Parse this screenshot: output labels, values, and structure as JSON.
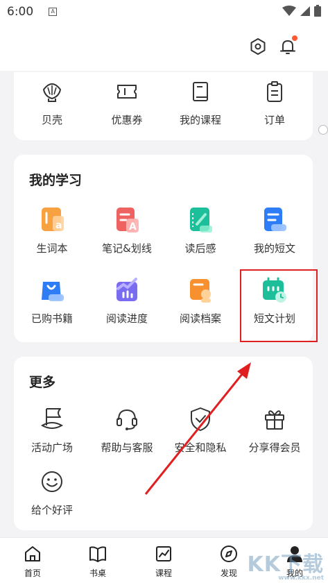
{
  "status": {
    "time": "6:00",
    "sim_label": "A"
  },
  "top_row": [
    {
      "label": "贝壳",
      "icon": "shell-icon"
    },
    {
      "label": "优惠券",
      "icon": "coupon-icon"
    },
    {
      "label": "我的课程",
      "icon": "book-icon"
    },
    {
      "label": "订单",
      "icon": "clipboard-icon"
    }
  ],
  "study": {
    "title": "我的学习",
    "items": [
      {
        "label": "生词本",
        "icon": "vocabulary-icon",
        "color": "#f7902f"
      },
      {
        "label": "笔记&划线",
        "icon": "notes-icon",
        "color": "#ee5a5a"
      },
      {
        "label": "读后感",
        "icon": "reflection-icon",
        "color": "#1dbe9a"
      },
      {
        "label": "我的短文",
        "icon": "essay-icon",
        "color": "#2f7df6"
      },
      {
        "label": "已购书籍",
        "icon": "bag-icon",
        "color": "#2f7df6"
      },
      {
        "label": "阅读进度",
        "icon": "progress-icon",
        "color": "#7a6cf0"
      },
      {
        "label": "阅读档案",
        "icon": "archive-icon",
        "color": "#f7902f"
      },
      {
        "label": "短文计划",
        "icon": "plan-icon",
        "color": "#1dbe9a"
      }
    ]
  },
  "more": {
    "title": "更多",
    "items": [
      {
        "label": "活动广场",
        "icon": "flag-icon"
      },
      {
        "label": "帮助与客服",
        "icon": "headset-icon"
      },
      {
        "label": "安全和隐私",
        "icon": "shield-icon"
      },
      {
        "label": "分享得会员",
        "icon": "gift-icon"
      },
      {
        "label": "给个好评",
        "icon": "smile-icon"
      }
    ]
  },
  "tabs": [
    {
      "label": "首页",
      "icon": "home-icon"
    },
    {
      "label": "书桌",
      "icon": "open-book-icon"
    },
    {
      "label": "课程",
      "icon": "chart-icon"
    },
    {
      "label": "发现",
      "icon": "compass-icon"
    },
    {
      "label": "我的",
      "icon": "person-icon"
    }
  ],
  "watermark": {
    "big": "KK下载",
    "small": "www.kkx.net"
  }
}
